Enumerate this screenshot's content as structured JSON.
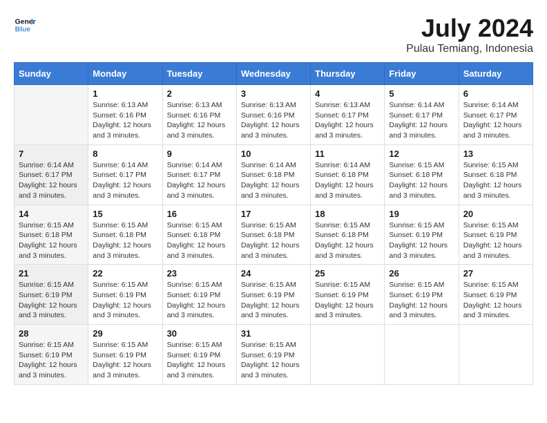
{
  "logo": {
    "line1": "General",
    "line2": "Blue"
  },
  "title": "July 2024",
  "location": "Pulau Temiang, Indonesia",
  "days_of_week": [
    "Sunday",
    "Monday",
    "Tuesday",
    "Wednesday",
    "Thursday",
    "Friday",
    "Saturday"
  ],
  "weeks": [
    [
      {
        "day": "",
        "info": ""
      },
      {
        "day": "1",
        "info": "Sunrise: 6:13 AM\nSunset: 6:16 PM\nDaylight: 12 hours\nand 3 minutes."
      },
      {
        "day": "2",
        "info": "Sunrise: 6:13 AM\nSunset: 6:16 PM\nDaylight: 12 hours\nand 3 minutes."
      },
      {
        "day": "3",
        "info": "Sunrise: 6:13 AM\nSunset: 6:16 PM\nDaylight: 12 hours\nand 3 minutes."
      },
      {
        "day": "4",
        "info": "Sunrise: 6:13 AM\nSunset: 6:17 PM\nDaylight: 12 hours\nand 3 minutes."
      },
      {
        "day": "5",
        "info": "Sunrise: 6:14 AM\nSunset: 6:17 PM\nDaylight: 12 hours\nand 3 minutes."
      },
      {
        "day": "6",
        "info": "Sunrise: 6:14 AM\nSunset: 6:17 PM\nDaylight: 12 hours\nand 3 minutes."
      }
    ],
    [
      {
        "day": "7",
        "info": "Sunrise: 6:14 AM\nSunset: 6:17 PM\nDaylight: 12 hours\nand 3 minutes."
      },
      {
        "day": "8",
        "info": "Sunrise: 6:14 AM\nSunset: 6:17 PM\nDaylight: 12 hours\nand 3 minutes."
      },
      {
        "day": "9",
        "info": "Sunrise: 6:14 AM\nSunset: 6:17 PM\nDaylight: 12 hours\nand 3 minutes."
      },
      {
        "day": "10",
        "info": "Sunrise: 6:14 AM\nSunset: 6:18 PM\nDaylight: 12 hours\nand 3 minutes."
      },
      {
        "day": "11",
        "info": "Sunrise: 6:14 AM\nSunset: 6:18 PM\nDaylight: 12 hours\nand 3 minutes."
      },
      {
        "day": "12",
        "info": "Sunrise: 6:15 AM\nSunset: 6:18 PM\nDaylight: 12 hours\nand 3 minutes."
      },
      {
        "day": "13",
        "info": "Sunrise: 6:15 AM\nSunset: 6:18 PM\nDaylight: 12 hours\nand 3 minutes."
      }
    ],
    [
      {
        "day": "14",
        "info": "Sunrise: 6:15 AM\nSunset: 6:18 PM\nDaylight: 12 hours\nand 3 minutes."
      },
      {
        "day": "15",
        "info": "Sunrise: 6:15 AM\nSunset: 6:18 PM\nDaylight: 12 hours\nand 3 minutes."
      },
      {
        "day": "16",
        "info": "Sunrise: 6:15 AM\nSunset: 6:18 PM\nDaylight: 12 hours\nand 3 minutes."
      },
      {
        "day": "17",
        "info": "Sunrise: 6:15 AM\nSunset: 6:18 PM\nDaylight: 12 hours\nand 3 minutes."
      },
      {
        "day": "18",
        "info": "Sunrise: 6:15 AM\nSunset: 6:18 PM\nDaylight: 12 hours\nand 3 minutes."
      },
      {
        "day": "19",
        "info": "Sunrise: 6:15 AM\nSunset: 6:19 PM\nDaylight: 12 hours\nand 3 minutes."
      },
      {
        "day": "20",
        "info": "Sunrise: 6:15 AM\nSunset: 6:19 PM\nDaylight: 12 hours\nand 3 minutes."
      }
    ],
    [
      {
        "day": "21",
        "info": "Sunrise: 6:15 AM\nSunset: 6:19 PM\nDaylight: 12 hours\nand 3 minutes."
      },
      {
        "day": "22",
        "info": "Sunrise: 6:15 AM\nSunset: 6:19 PM\nDaylight: 12 hours\nand 3 minutes."
      },
      {
        "day": "23",
        "info": "Sunrise: 6:15 AM\nSunset: 6:19 PM\nDaylight: 12 hours\nand 3 minutes."
      },
      {
        "day": "24",
        "info": "Sunrise: 6:15 AM\nSunset: 6:19 PM\nDaylight: 12 hours\nand 3 minutes."
      },
      {
        "day": "25",
        "info": "Sunrise: 6:15 AM\nSunset: 6:19 PM\nDaylight: 12 hours\nand 3 minutes."
      },
      {
        "day": "26",
        "info": "Sunrise: 6:15 AM\nSunset: 6:19 PM\nDaylight: 12 hours\nand 3 minutes."
      },
      {
        "day": "27",
        "info": "Sunrise: 6:15 AM\nSunset: 6:19 PM\nDaylight: 12 hours\nand 3 minutes."
      }
    ],
    [
      {
        "day": "28",
        "info": "Sunrise: 6:15 AM\nSunset: 6:19 PM\nDaylight: 12 hours\nand 3 minutes."
      },
      {
        "day": "29",
        "info": "Sunrise: 6:15 AM\nSunset: 6:19 PM\nDaylight: 12 hours\nand 3 minutes."
      },
      {
        "day": "30",
        "info": "Sunrise: 6:15 AM\nSunset: 6:19 PM\nDaylight: 12 hours\nand 3 minutes."
      },
      {
        "day": "31",
        "info": "Sunrise: 6:15 AM\nSunset: 6:19 PM\nDaylight: 12 hours\nand 3 minutes."
      },
      {
        "day": "",
        "info": ""
      },
      {
        "day": "",
        "info": ""
      },
      {
        "day": "",
        "info": ""
      }
    ]
  ]
}
